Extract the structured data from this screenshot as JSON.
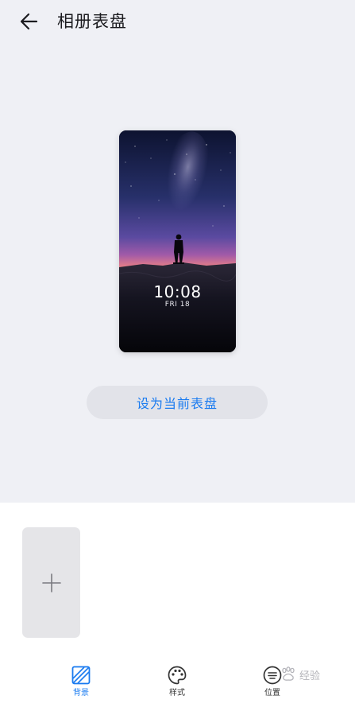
{
  "header": {
    "back_icon": "arrow-left-icon",
    "title": "相册表盘"
  },
  "preview": {
    "time": "10:08",
    "date": "FRI 18"
  },
  "actions": {
    "set_current": "设为当前表盘"
  },
  "gallery": {
    "add_icon": "plus-icon"
  },
  "tabs": [
    {
      "label": "背景",
      "icon": "background-icon",
      "active": true
    },
    {
      "label": "样式",
      "icon": "palette-icon",
      "active": false
    },
    {
      "label": "位置",
      "icon": "position-icon",
      "active": false
    }
  ],
  "watermark": {
    "text": "经验"
  },
  "colors": {
    "accent": "#1a7bf0",
    "top_background": "#eff0f5",
    "button_background": "#e2e3e9"
  }
}
